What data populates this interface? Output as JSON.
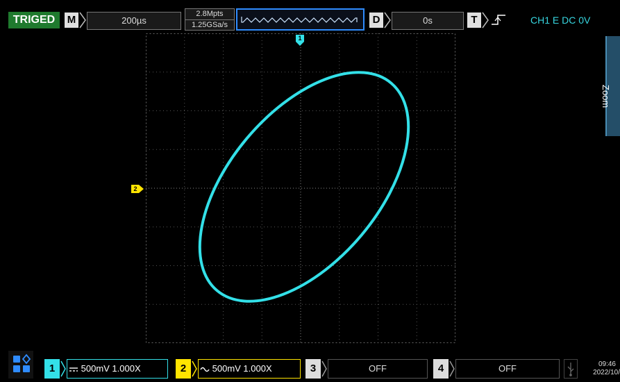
{
  "header": {
    "status": "TRIGED",
    "timebase_letter": "M",
    "timebase_value": "200µs",
    "memory_depth": "2.8Mpts",
    "sample_rate": "1.25GSa/s",
    "delay_letter": "D",
    "delay_value": "0s",
    "trigger_letter": "T",
    "trigger_info": "CH1 E DC 0V"
  },
  "side_tab": {
    "label": "Zoom"
  },
  "markers": {
    "trigger_marker": "1",
    "ch2_marker": "2"
  },
  "channels": [
    {
      "number": "1",
      "setting": "500mV 1.000X",
      "color": "#33e0e8"
    },
    {
      "number": "2",
      "setting": "500mV 1.000X",
      "color": "#ffe400"
    },
    {
      "number": "3",
      "setting": "OFF"
    },
    {
      "number": "4",
      "setting": "OFF"
    }
  ],
  "clock": {
    "time": "09:46",
    "date": "2022/10/"
  },
  "colors": {
    "trace": "#33e0e8",
    "ch2": "#ffe400",
    "status_bg": "#1f7a2e",
    "accent": "#2f8cff"
  }
}
